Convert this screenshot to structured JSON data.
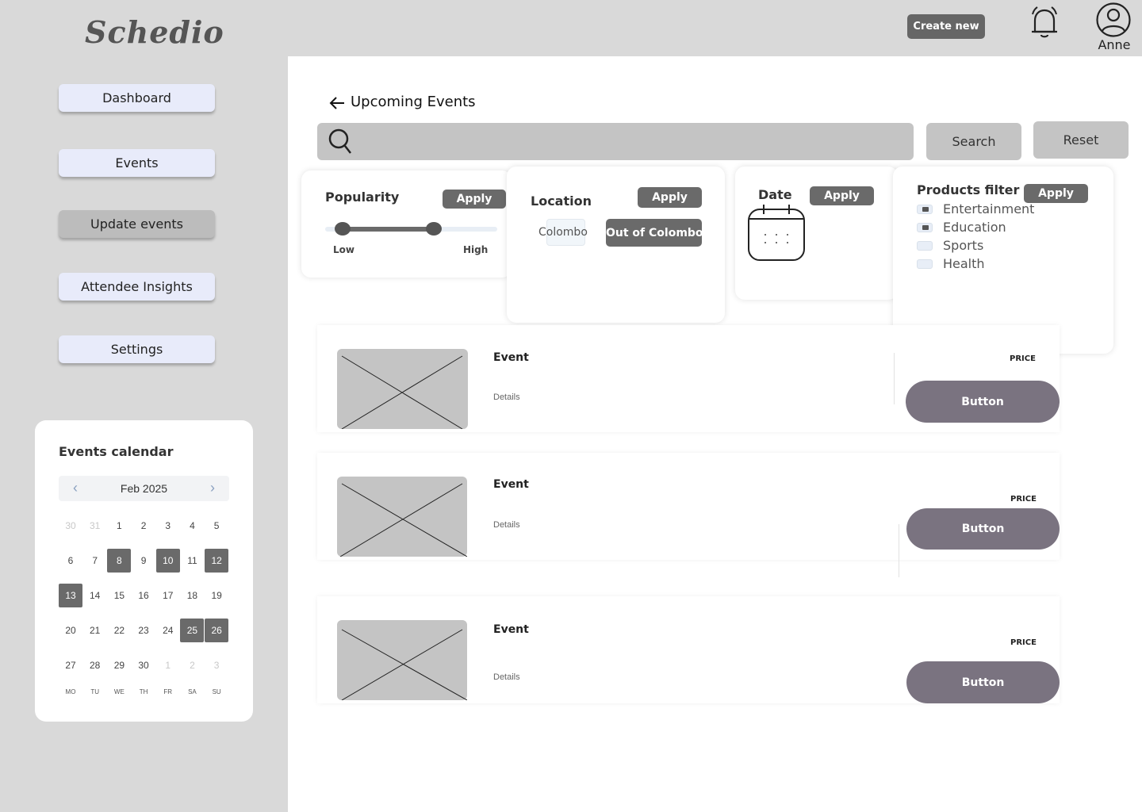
{
  "app": {
    "name": "Schedio"
  },
  "sidebar": {
    "items": [
      {
        "label": "Dashboard"
      },
      {
        "label": "Events"
      },
      {
        "label": "Update events"
      },
      {
        "label": "Attendee Insights"
      },
      {
        "label": "Settings"
      }
    ],
    "active_item": "Update events"
  },
  "calendar": {
    "title": "Events calendar",
    "month": "Feb 2025",
    "prev_icon": "chevron-left-icon",
    "next_icon": "chevron-right-icon",
    "weeks": [
      [
        "30",
        "31",
        "1",
        "2",
        "3",
        "4",
        "5"
      ],
      [
        "6",
        "7",
        "8",
        "9",
        "10",
        "11",
        "12"
      ],
      [
        "13",
        "14",
        "15",
        "16",
        "17",
        "18",
        "19"
      ],
      [
        "20",
        "21",
        "22",
        "23",
        "24",
        "25",
        "26"
      ],
      [
        "27",
        "28",
        "29",
        "30",
        "1",
        "2",
        "3"
      ]
    ],
    "muted_days": [
      "30",
      "31",
      "1-next",
      "2-next",
      "3-next"
    ],
    "highlighted_days": [
      "8",
      "10",
      "12",
      "13",
      "25",
      "26"
    ],
    "weekdays": [
      "MO",
      "TU",
      "WE",
      "TH",
      "FR",
      "SA",
      "SU"
    ]
  },
  "header": {
    "create_label": "Create new",
    "user_name": "Anne",
    "bell_icon": "bell-icon",
    "avatar_icon": "user-avatar-icon"
  },
  "main": {
    "title": "Upcoming Events",
    "search": {
      "placeholder": "",
      "value": ""
    },
    "search_label": "Search",
    "reset_label": "Reset"
  },
  "filters": {
    "popularity": {
      "title": "Popularity",
      "apply": "Apply",
      "low": "Low",
      "high": "High"
    },
    "location": {
      "title": "Location",
      "apply": "Apply",
      "options": [
        "Colombo",
        "Out of Colombo"
      ],
      "selected": "Out of Colombo"
    },
    "date": {
      "title": "Date",
      "apply": "Apply"
    },
    "products": {
      "title": "Products filter",
      "apply": "Apply",
      "options": [
        {
          "label": "Entertainment",
          "checked": true
        },
        {
          "label": "Education",
          "checked": true
        },
        {
          "label": "Sports",
          "checked": false
        },
        {
          "label": "Health",
          "checked": false
        }
      ]
    }
  },
  "events": [
    {
      "title": "Event",
      "details": "Details",
      "price": "PRICE",
      "button": "Button"
    },
    {
      "title": "Event",
      "details": "Details",
      "price": "PRICE",
      "button": "Button"
    },
    {
      "title": "Event",
      "details": "Details",
      "price": "PRICE",
      "button": "Button"
    }
  ],
  "colors": {
    "sidebar_bg": "#d9d9d9",
    "nav_button": "#e8ebfa",
    "nav_active": "#bcbcbc",
    "dark_button": "#6a6a6a",
    "event_button": "#7a7380"
  }
}
